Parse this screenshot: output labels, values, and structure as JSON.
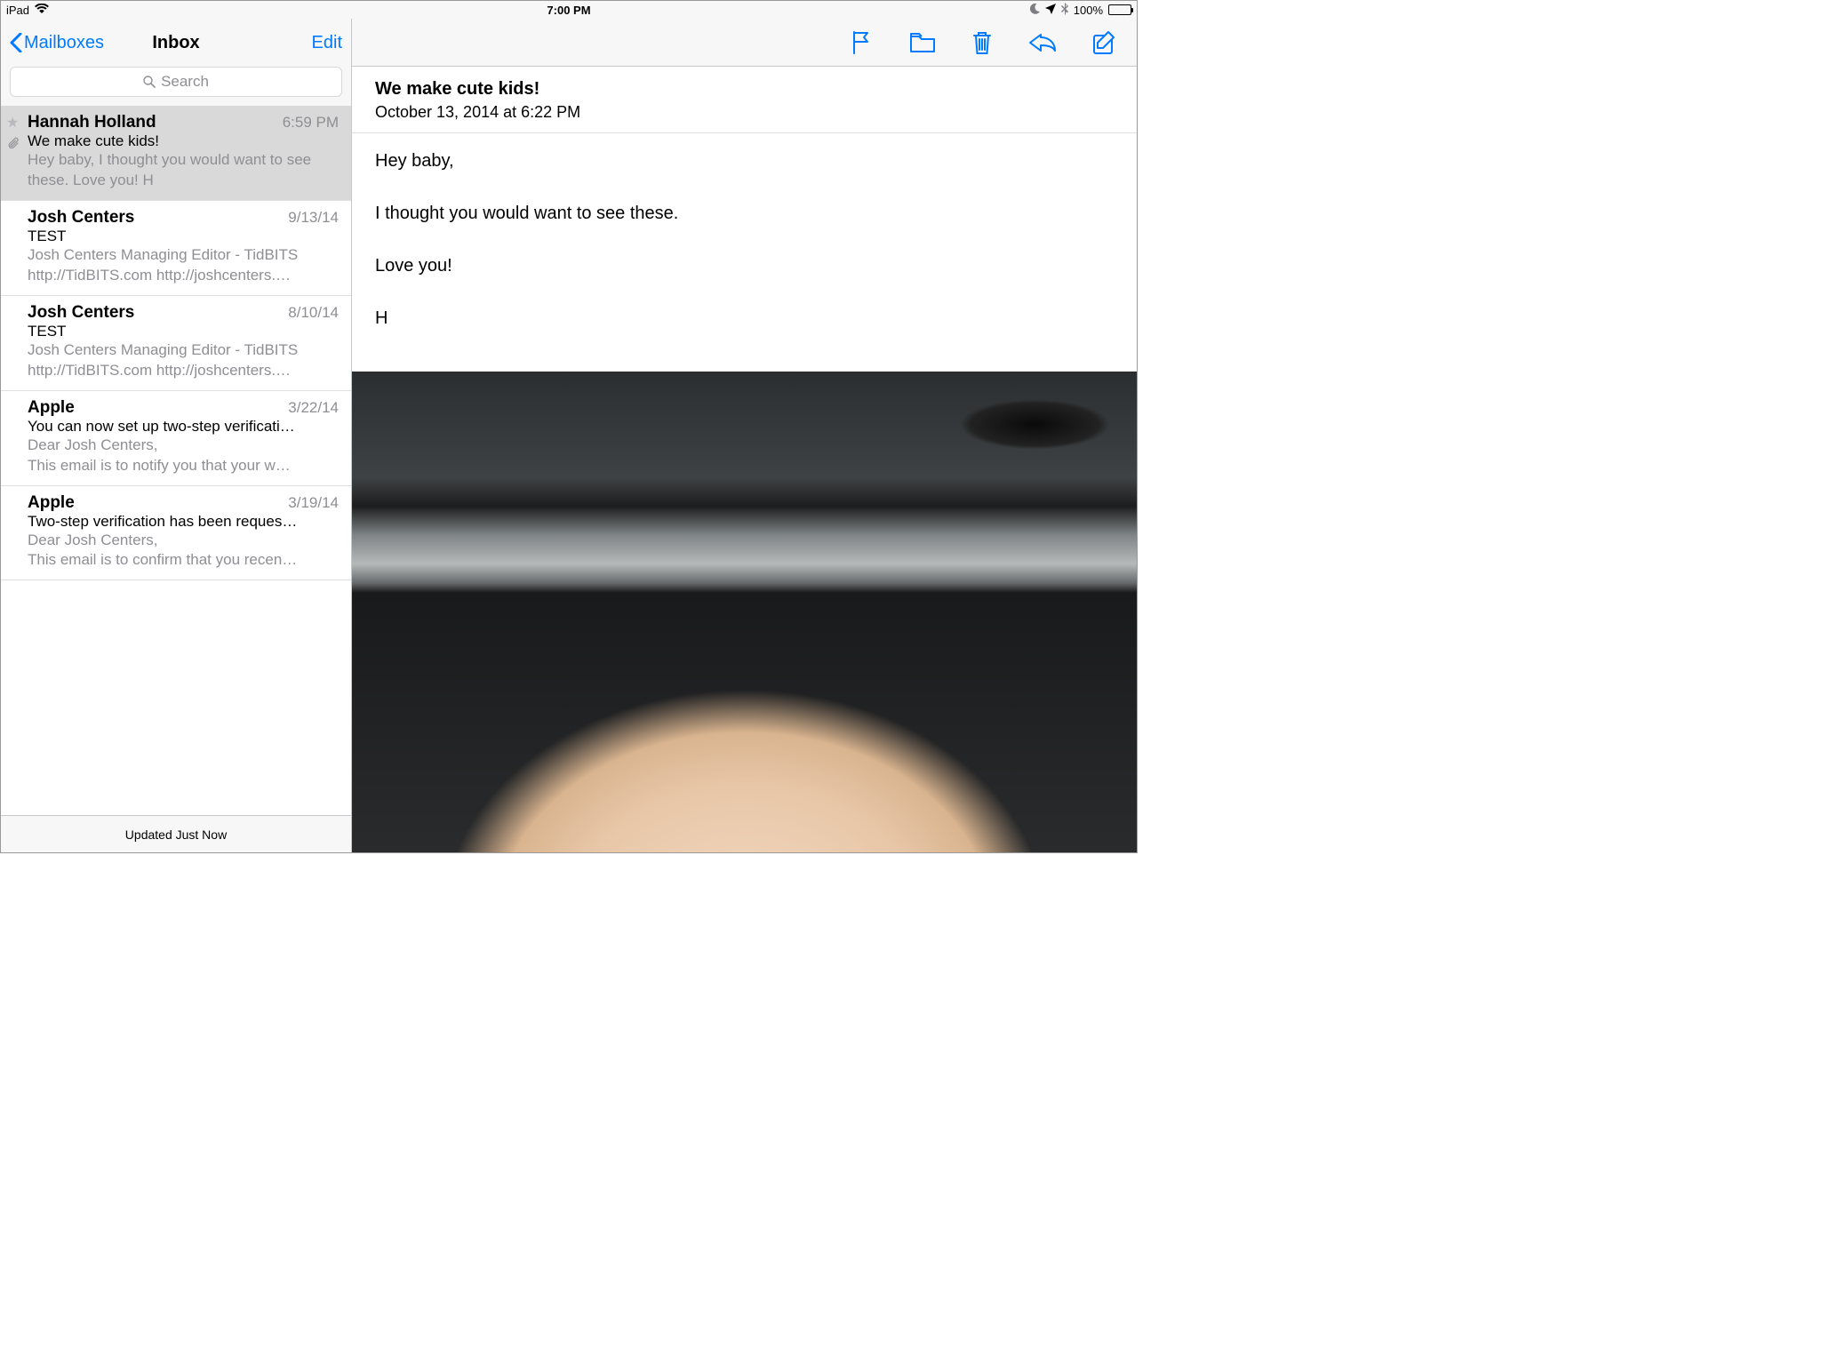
{
  "statusbar": {
    "device": "iPad",
    "time": "7:00 PM",
    "battery_pct": "100%"
  },
  "sidebar": {
    "back_label": "Mailboxes",
    "title": "Inbox",
    "edit_label": "Edit",
    "search_placeholder": "Search",
    "footer": "Updated Just Now",
    "messages": [
      {
        "sender": "Hannah Holland",
        "date": "6:59 PM",
        "subject": "We make cute kids!",
        "preview": "Hey baby, I thought you would want to see these. Love you! H",
        "selected": true,
        "has_attachment": true
      },
      {
        "sender": "Josh Centers",
        "date": "9/13/14",
        "subject": "TEST",
        "preview": "Josh Centers Managing Editor - TidBITS http://TidBITS.com http://joshcenters.…"
      },
      {
        "sender": "Josh Centers",
        "date": "8/10/14",
        "subject": "TEST",
        "preview": "Josh Centers Managing Editor - TidBITS http://TidBITS.com http://joshcenters.…"
      },
      {
        "sender": "Apple",
        "date": "3/22/14",
        "subject": "You can now set up two-step verificati…",
        "preview": "Dear Josh Centers,\nThis email is to notify you that your w…"
      },
      {
        "sender": "Apple",
        "date": "3/19/14",
        "subject": "Two-step verification has been reques…",
        "preview": "Dear Josh Centers,\nThis email is to confirm that you recen…"
      }
    ]
  },
  "mail": {
    "subject": "We make cute kids!",
    "datetime": "October 13, 2014 at 6:22 PM",
    "body_lines": [
      "Hey baby,",
      "I thought you would want to see these.",
      "Love you!",
      "H"
    ],
    "attachment_desc": "Photo of a toddler's face in a car"
  }
}
